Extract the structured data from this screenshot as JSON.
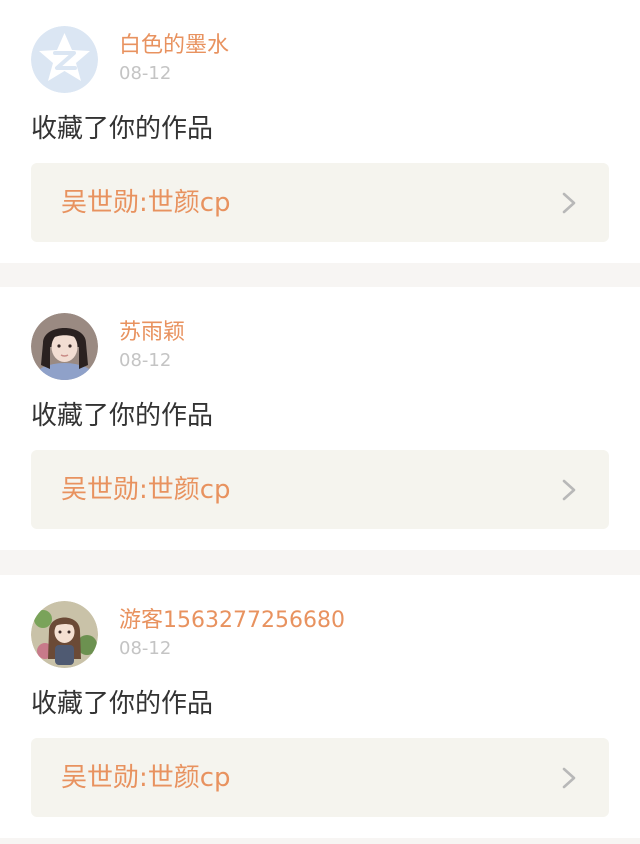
{
  "notifications": [
    {
      "username": "白色的墨水",
      "date": "08-12",
      "action": "收藏了你的作品",
      "work_title": "吴世勋:世颜cp",
      "avatar": "default-qq-avatar-icon"
    },
    {
      "username": "苏雨颖",
      "date": "08-12",
      "action": "收藏了你的作品",
      "work_title": "吴世勋:世颜cp",
      "avatar": "user-photo-avatar"
    },
    {
      "username": "游客1563277256680",
      "date": "08-12",
      "action": "收藏了你的作品",
      "work_title": "吴世勋:世颜cp",
      "avatar": "anime-illustration-avatar"
    }
  ],
  "colors": {
    "username": "#e8925f",
    "work_title": "#e8925f",
    "date": "#c4c4c4",
    "action_text": "#333333",
    "link_bg": "#f5f4ee",
    "divider": "#f7f5f3"
  },
  "icons": {
    "chevron": "chevron-right-icon"
  }
}
